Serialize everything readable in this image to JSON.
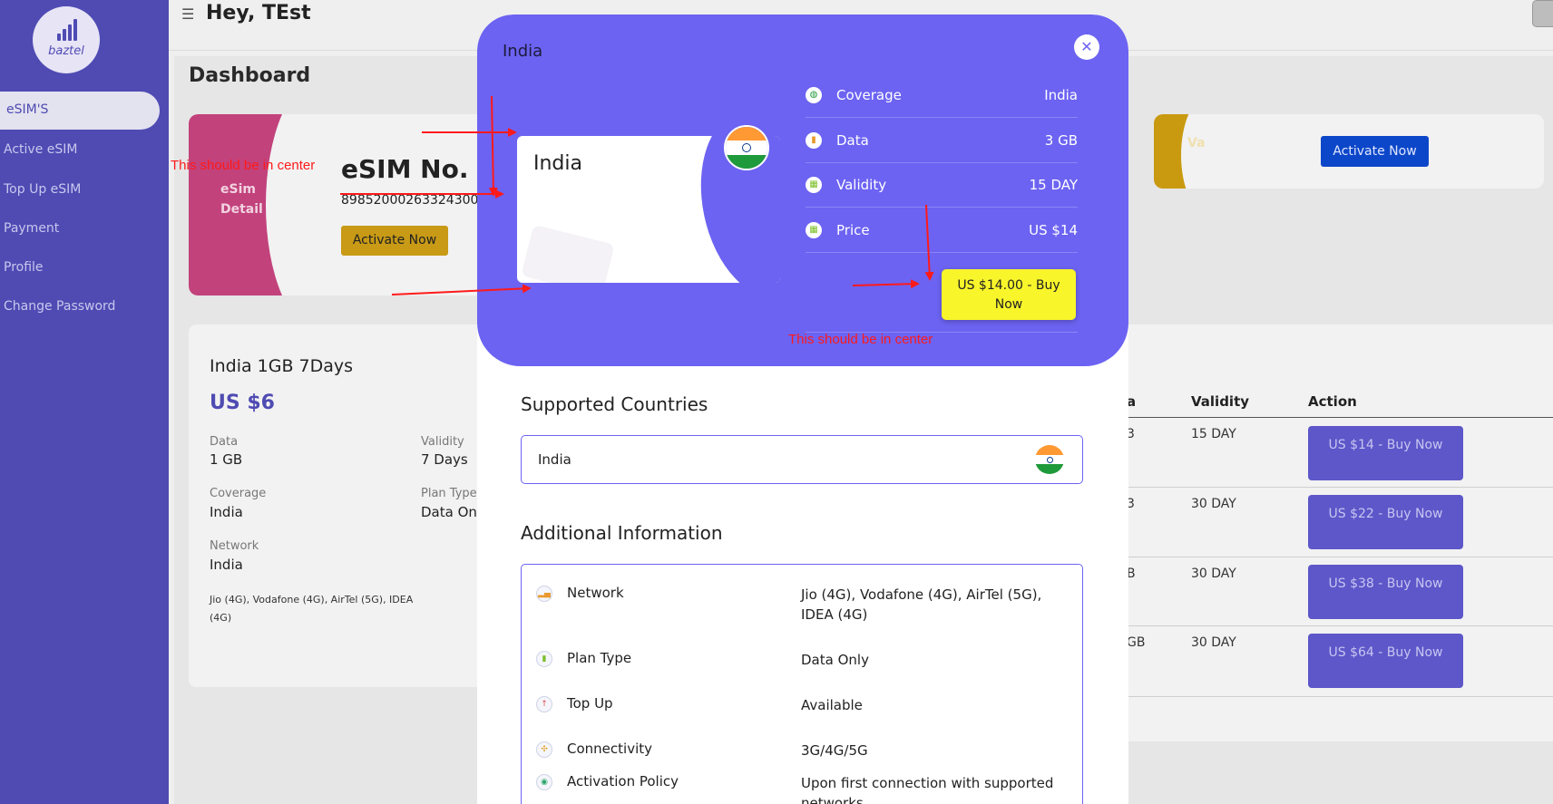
{
  "sidebar": {
    "brand": "baztel",
    "items": [
      {
        "label": "eSIM'S"
      },
      {
        "label": "Active eSIM"
      },
      {
        "label": "Top Up eSIM"
      },
      {
        "label": "Payment"
      },
      {
        "label": "Profile"
      },
      {
        "label": "Change Password"
      }
    ]
  },
  "header": {
    "greeting": "Hey, TEst"
  },
  "dashboard": {
    "title": "Dashboard",
    "esim_card": {
      "detail_line1": "eSim",
      "detail_line2": "Detail",
      "title": "eSIM No.",
      "iccid": "89852000263324300",
      "activate_label": "Activate Now"
    },
    "card2": {
      "partial_label": "Va",
      "activate_label": "Activate Now"
    },
    "plan": {
      "title": "India 1GB 7Days",
      "price": "US $6",
      "data_label": "Data",
      "data_value": "1 GB",
      "validity_label": "Validity",
      "validity_value": "7 Days",
      "coverage_label": "Coverage",
      "coverage_value": "India",
      "plan_type_label": "Plan Type",
      "plan_type_value": "Data Onl",
      "network_label": "Network",
      "network_value": "India",
      "network_list": "Jio (4G), Vodafone (4G), AirTel (5G), IDEA (4G)"
    },
    "table": {
      "headers": [
        "a",
        "Validity",
        "Action"
      ],
      "rows": [
        {
          "data": "3",
          "validity": "15 DAY",
          "action": "US $14 - Buy Now"
        },
        {
          "data": "3",
          "validity": "30 DAY",
          "action": "US $22 - Buy Now"
        },
        {
          "data": "B",
          "validity": "30 DAY",
          "action": "US $38 - Buy Now"
        },
        {
          "data": "GB",
          "validity": "30 DAY",
          "action": "US $64 - Buy Now"
        }
      ]
    }
  },
  "annotations": {
    "note1": "This should be in center",
    "note2": "This should be in center"
  },
  "modal": {
    "title": "India",
    "close_glyph": "✕",
    "card_country": "India",
    "info": [
      {
        "label": "Coverage",
        "value": "India",
        "icon": "globe-icon",
        "glyph": "◍",
        "color": "#1f9a3a"
      },
      {
        "label": "Data",
        "value": "3 GB",
        "icon": "data-icon",
        "glyph": "▮",
        "color": "#e89a2e"
      },
      {
        "label": "Validity",
        "value": "15 DAY",
        "icon": "calendar-icon",
        "glyph": "▦",
        "color": "#7bbf2a"
      },
      {
        "label": "Price",
        "value": "US $14",
        "icon": "price-icon",
        "glyph": "▦",
        "color": "#7bbf2a"
      }
    ],
    "buy_label": "US $14.00 - Buy Now",
    "supported_title": "Supported Countries",
    "supported_country": "India",
    "additional_title": "Additional Information",
    "additional": [
      {
        "label": "Network",
        "value": "Jio (4G), Vodafone (4G), AirTel (5G), IDEA (4G)",
        "icon": "signal-icon",
        "glyph": "▂▄▆",
        "color": "#e89a2e"
      },
      {
        "label": "Plan Type",
        "value": "Data Only",
        "icon": "sim-icon",
        "glyph": "▮",
        "color": "#7bbf2a"
      },
      {
        "label": "Top Up",
        "value": "Available",
        "icon": "topup-icon",
        "glyph": "↑",
        "color": "#e05050"
      },
      {
        "label": "Connectivity",
        "value": "3G/4G/5G",
        "icon": "connectivity-icon",
        "glyph": "✣",
        "color": "#e8a22e"
      },
      {
        "label": "Activation Policy",
        "value": "Upon first connection with supported networks",
        "icon": "activation-icon",
        "glyph": "◉",
        "color": "#2aa56a"
      }
    ]
  }
}
